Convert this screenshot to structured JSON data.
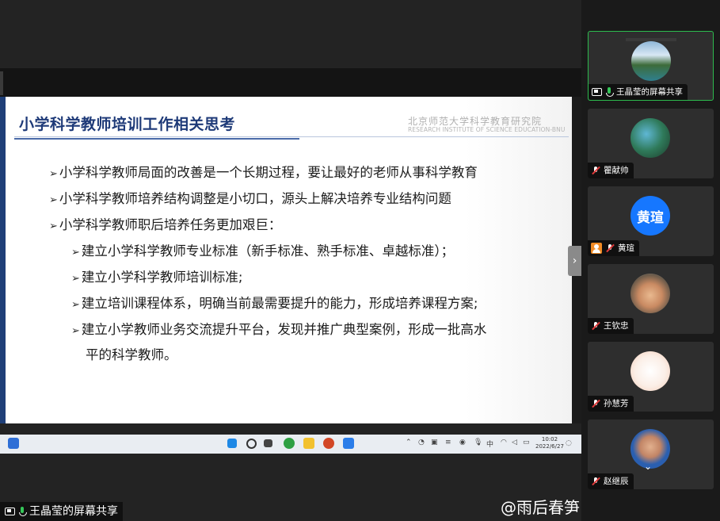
{
  "slide": {
    "title": "小学科学教师培训工作相关思考",
    "institution_cn": "北京师范大学科学教育研究院",
    "institution_en": "RESEARCH INSTITUTE OF SCIENCE EDUCATION-BNU",
    "bullet_marker": "➢",
    "bullets": [
      "小学科学教师局面的改善是一个长期过程，要让最好的老师从事科学教育",
      "小学科学教师培养结构调整是小切口，源头上解决培养专业结构问题",
      "小学科学教师职后培养任务更加艰巨："
    ],
    "sub_bullets": [
      "建立小学科学教师专业标准（新手标准、熟手标准、卓越标准）；",
      "建立小学科学教师培训标准;",
      "建立培训课程体系，明确当前最需要提升的能力，形成培养课程方案;",
      "建立小学教师业务交流提升平台，发现并推广典型案例，形成一批高水",
      "平的科学教师。"
    ]
  },
  "taskbar": {
    "time": "10:02",
    "date": "2022/6/27",
    "tray_lang": "中"
  },
  "share_status": {
    "label": "王晶莹的屏幕共享"
  },
  "watermark": "@雨后春笋",
  "participants": [
    {
      "name": "王晶莹的屏幕共享",
      "avatar": "lake-photo-avatar",
      "mic": "on",
      "active": true
    },
    {
      "name": "瞿献帅",
      "avatar": "bird-photo-avatar",
      "mic": "muted",
      "active": false
    },
    {
      "name": "黄瑄",
      "avatar_text": "黄瑄",
      "avatar_color": "#1677ff",
      "mic": "muted",
      "active": false
    },
    {
      "name": "王钦忠",
      "avatar": "child-photo-avatar",
      "mic": "muted",
      "active": false
    },
    {
      "name": "孙慧芳",
      "avatar": "cartoon-avatar",
      "mic": "muted",
      "active": false
    },
    {
      "name": "赵继辰",
      "avatar": "man-photo-avatar",
      "mic": "muted",
      "active": false
    }
  ],
  "colors": {
    "active_border": "#2dbb4e",
    "slide_title": "#1e3a78",
    "mute_red": "#e03a3a"
  }
}
